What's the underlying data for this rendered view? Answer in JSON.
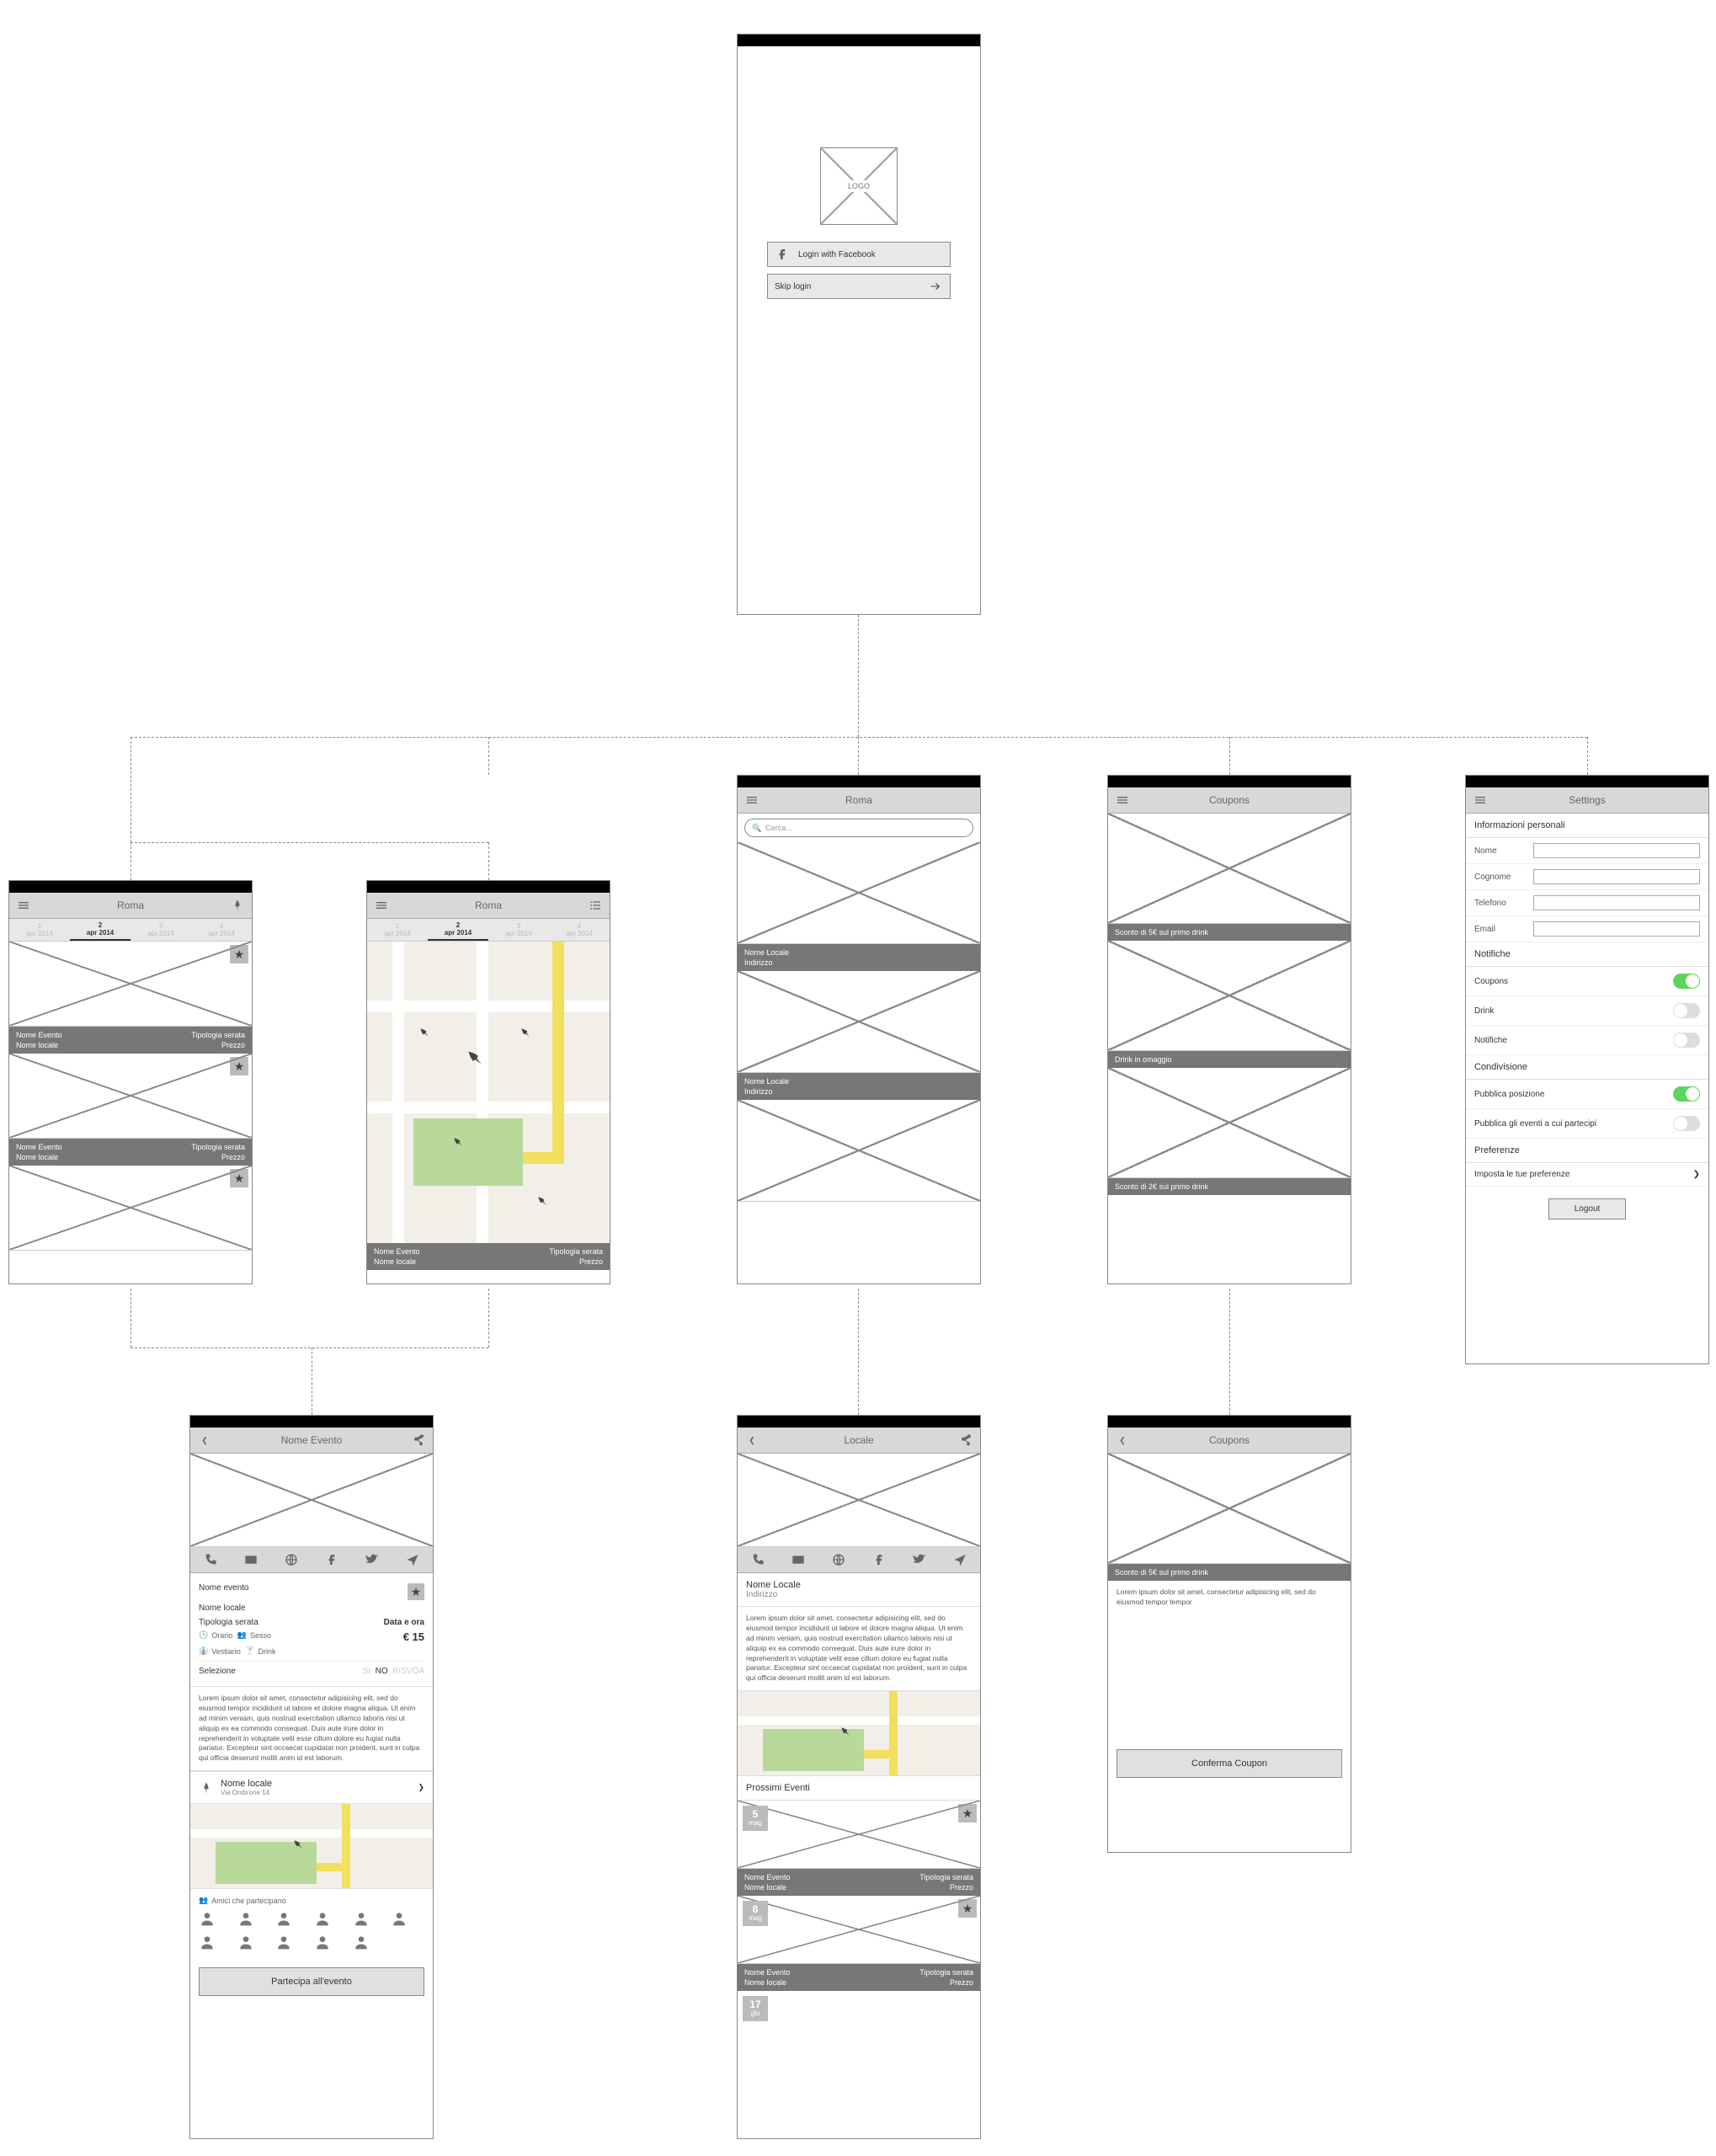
{
  "login": {
    "logo": "LOGO",
    "fb": "Login with Facebook",
    "skip": "Skip login"
  },
  "city": "Roma",
  "dates": [
    {
      "n": "1",
      "l": "apr 2014"
    },
    {
      "n": "2",
      "l": "apr 2014"
    },
    {
      "n": "3",
      "l": "apr 2014"
    },
    {
      "n": "4",
      "l": "apr 2014"
    }
  ],
  "event": {
    "name": "Nome Evento",
    "venue": "Nome locale",
    "type": "Tipologia serata",
    "price": "Prezzo"
  },
  "venue": {
    "name": "Nome Locale",
    "addr": "Indirizzo"
  },
  "search": {
    "ph": "Cerca..."
  },
  "coupons": {
    "title": "Coupons",
    "c1": "Sconto di 5€ sul primo drink",
    "c2": "Drink in omaggio",
    "c3": "Sconto di 2€ sul primo drink",
    "confirm": "Conferma Coupon",
    "lorem": "Lorem ipsum dolor sit amet, consectetur adipisicing elit, sed do eiusmod tempor tempor"
  },
  "settings": {
    "title": "Settings",
    "h1": "Informazioni personali",
    "nome": "Nome",
    "cognome": "Cognome",
    "telefono": "Telefono",
    "email": "Email",
    "h2": "Notifiche",
    "coupons": "Coupons",
    "drink": "Drink",
    "notifiche": "Notifiche",
    "h3": "Condivisione",
    "pos": "Pubblica posizione",
    "eventi": "Pubblica gli eventi a cui partecipi",
    "h4": "Preferenze",
    "pref": "Imposta le tue preferenze",
    "logout": "Logout"
  },
  "detail": {
    "title": "Nome Evento",
    "name": "Nome evento",
    "venue": "Nome locale",
    "type": "Tipologia serata",
    "when": "Data e ora",
    "orario": "Orario",
    "sesso": "Sesso",
    "vestiario": "Vestiario",
    "drink": "Drink",
    "euro": "€ 15",
    "selezione": "Selezione",
    "si": "SI",
    "no": "NO",
    "risvoa": "RISVOA",
    "locname": "Nome locale",
    "locaddr": "Via Ombrone 14",
    "friends": "Amici che partecipano",
    "cta": "Partecipa all'evento",
    "lorem": "Lorem ipsum dolor sit amet, consectetur adipisicing elit, sed do eiusmod tempor incididunt ut labore et dolore magna aliqua. Ut enim ad minim veniam, quis nostrud exercitation ullamco laboris nisi ut aliquip ex ea commodo consequat. Duis aute irure dolor in reprehenderit in voluptate velit esse cillum dolore eu fugiat nulla pariatur. Excepteur sint occaecat cupidatat non proident, sunt in culpa qui officia deserunt mollit anim id est laborum."
  },
  "locale": {
    "title": "Locale",
    "prossimi": "Prossimi Eventi",
    "dates": [
      {
        "d": "5",
        "m": "mag"
      },
      {
        "d": "8",
        "m": "mag"
      },
      {
        "d": "17",
        "m": "giu"
      }
    ]
  }
}
